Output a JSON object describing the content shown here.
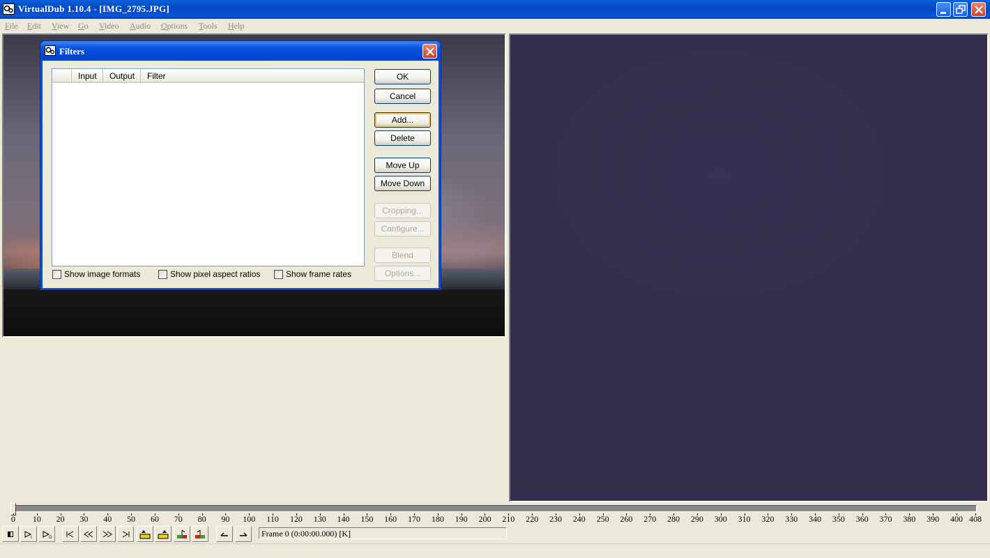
{
  "window": {
    "title": "VirtualDub 1.10.4 - [IMG_2795.JPG]"
  },
  "menu": [
    "File",
    "Edit",
    "View",
    "Go",
    "Video",
    "Audio",
    "Options",
    "Tools",
    "Help"
  ],
  "dialog": {
    "title": "Filters",
    "columns": [
      "Input",
      "Output",
      "Filter"
    ],
    "buttons": {
      "ok": "OK",
      "cancel": "Cancel",
      "add": "Add...",
      "delete": "Delete",
      "move_up": "Move Up",
      "move_down": "Move Down",
      "cropping": "Cropping...",
      "configure": "Configure...",
      "blend": "Blend",
      "options": "Options..."
    },
    "checkboxes": {
      "show_image_formats": "Show image formats",
      "show_pixel_aspect_ratios": "Show pixel aspect ratios",
      "show_frame_rates": "Show frame rates"
    }
  },
  "timeline": {
    "min": 0,
    "max": 408,
    "current": 0,
    "tick_labels": [
      "0",
      "10",
      "20",
      "30",
      "40",
      "50",
      "60",
      "70",
      "80",
      "90",
      "100",
      "110",
      "120",
      "130",
      "140",
      "150",
      "160",
      "170",
      "180",
      "190",
      "200",
      "210",
      "220",
      "230",
      "240",
      "250",
      "260",
      "270",
      "280",
      "290",
      "300",
      "310",
      "320",
      "330",
      "340",
      "350",
      "360",
      "370",
      "380",
      "390",
      "400",
      "408"
    ]
  },
  "status": {
    "frame_text": "Frame 0 (0:00:00.000) [K]"
  },
  "toolbar_icons": [
    "stop-icon",
    "play-input-icon",
    "play-output-icon",
    "start-icon",
    "prev-key-icon",
    "next-key-icon",
    "end-icon",
    "scene-rev-icon",
    "scene-fwd-icon",
    "mark-in-icon",
    "mark-out-icon",
    "selection-start-icon",
    "selection-end-icon"
  ],
  "colors": {
    "titlebar": "#0a55d6",
    "output_preview": "#342d4b",
    "default_button_ring": "#f9c55d"
  }
}
